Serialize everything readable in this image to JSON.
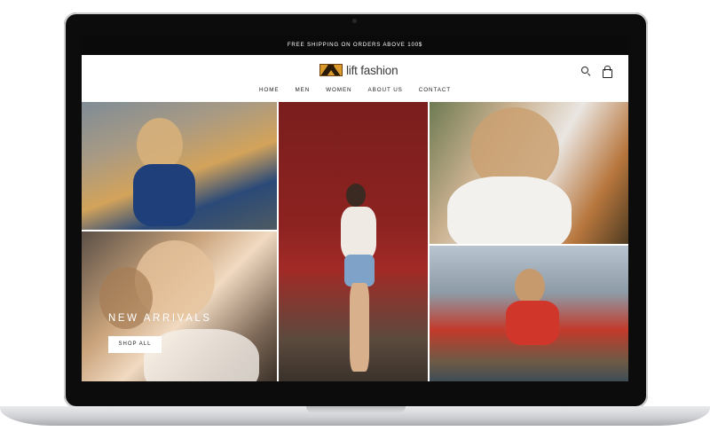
{
  "announcement": "FREE SHIPPING ON ORDERS ABOVE 100$",
  "logo": {
    "text": "lift fashion"
  },
  "nav": [
    "HOME",
    "MEN",
    "WOMEN",
    "ABOUT US",
    "CONTACT"
  ],
  "hero": {
    "title": "NEW ARRIVALS",
    "button_label": "SHOP ALL"
  },
  "icons": {
    "search": "search-icon",
    "cart": "shopping-bag-icon"
  },
  "colors": {
    "announcement_bg": "#0a0a0a",
    "logo_accent": "#d99a2b"
  }
}
